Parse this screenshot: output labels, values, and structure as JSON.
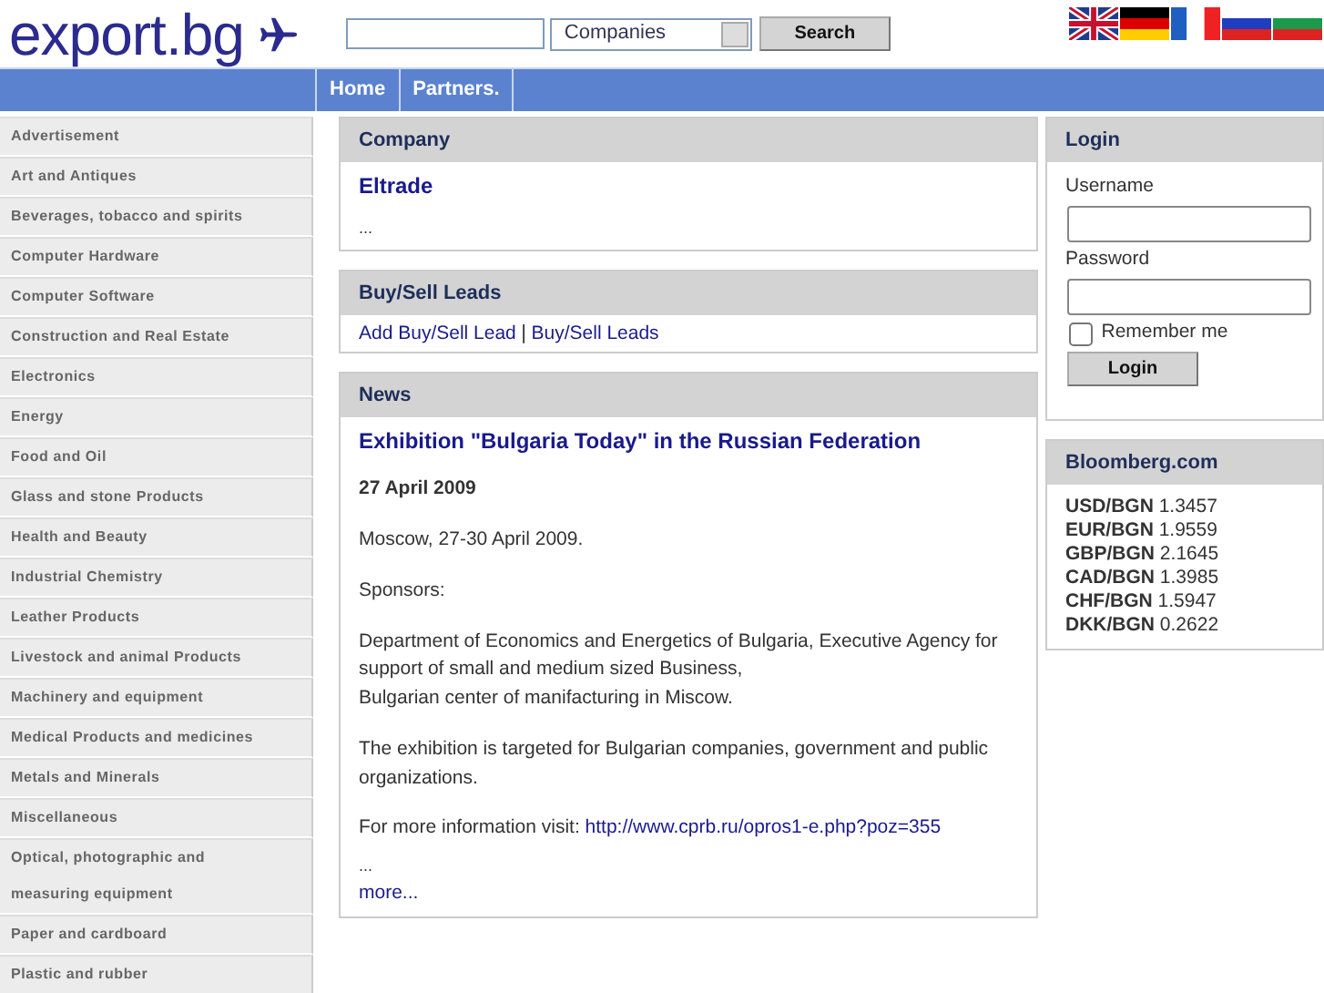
{
  "header": {
    "logo": "export.bg",
    "search": {
      "category": "Companies",
      "button": "Search"
    },
    "languages": [
      {
        "kind": "uk"
      },
      {
        "kind": "de"
      },
      {
        "kind": "fr"
      },
      {
        "kind": "ru"
      },
      {
        "kind": "bg"
      }
    ]
  },
  "nav": [
    "Home",
    "Partners."
  ],
  "sidebar": {
    "items": [
      "Advertisement",
      "Art and Antiques",
      "Beverages, tobacco and spirits",
      "Computer Hardware",
      "Computer Software",
      "Construction and Real Estate",
      "Electronics",
      "Energy",
      "Food and Oil",
      "Glass and stone Products",
      "Health and Beauty",
      "Industrial Chemistry",
      "Leather Products",
      "Livestock and animal Products",
      "Machinery and equipment",
      "Medical Products and medicines",
      "Metals and Minerals",
      "Miscellaneous",
      "Optical, photographic and measuring equipment",
      "Paper and cardboard",
      "Plastic and rubber"
    ]
  },
  "company": {
    "title": "Company",
    "name": "Eltrade",
    "excerpt": "..."
  },
  "leads": {
    "title": "Buy/Sell Leads",
    "links": [
      "Add Buy/Sell Lead",
      "Buy/Sell Leads"
    ],
    "separator": "|"
  },
  "news": {
    "title": "News",
    "headline": "Exhibition \"Bulgaria Today\" in the Russian Federation",
    "date": "27 April 2009",
    "paragraphs": [
      "Moscow, 27-30 April 2009.",
      "Sponsors:",
      "Department of Economics and Energetics of Bulgaria, Executive Agency for support of small and medium sized Business,\nBulgarian center of manifacturing in Miscow.",
      "The exhibition is targeted for Bulgarian companies, government and public organizations."
    ],
    "info_label": "For more information visit:",
    "info_link": "http://www.cprb.ru/opros1-e.php?poz=355",
    "ellipsis": "...",
    "more": "more..."
  },
  "login": {
    "title": "Login",
    "username_label": "Username",
    "password_label": "Password",
    "remember": {
      "label": "Remember me",
      "checked": false
    },
    "button": "Login"
  },
  "rates": {
    "title": "Bloomberg.com",
    "items": [
      {
        "pair": "USD/BGN",
        "value": "1.3457"
      },
      {
        "pair": "EUR/BGN",
        "value": "1.9559"
      },
      {
        "pair": "GBP/BGN",
        "value": "2.1645"
      },
      {
        "pair": "CAD/BGN",
        "value": "1.3985"
      },
      {
        "pair": "CHF/BGN",
        "value": "1.5947"
      },
      {
        "pair": "DKK/BGN",
        "value": "0.2622"
      }
    ]
  }
}
